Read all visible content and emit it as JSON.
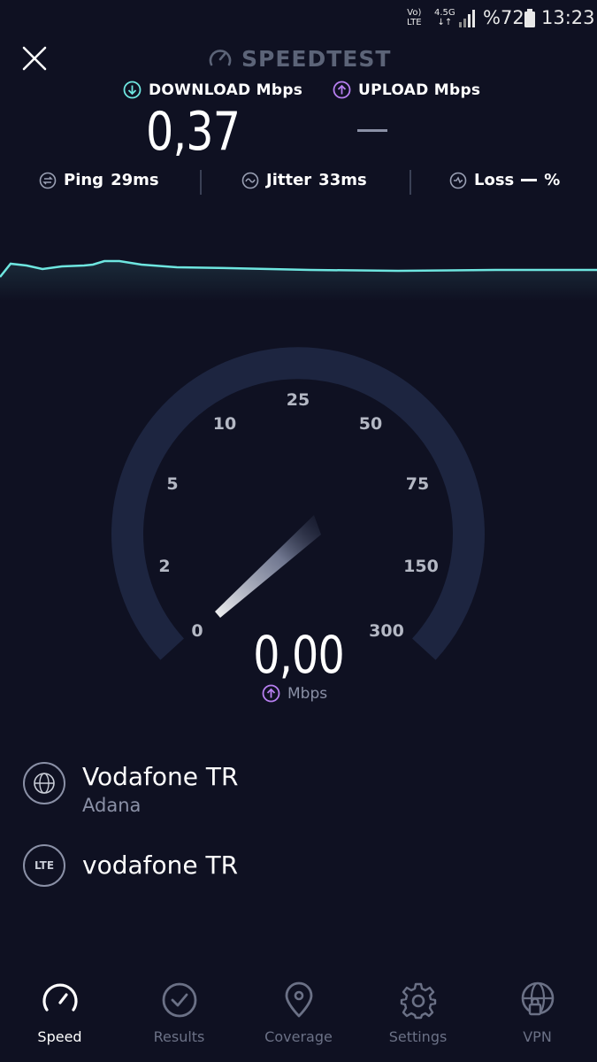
{
  "status_bar": {
    "volte_top": "Vo)",
    "volte_bottom": "LTE",
    "network_top": "4.5G",
    "network_bottom": "↓↑",
    "battery_percent": "%72",
    "time": "13:23"
  },
  "header": {
    "title": "SPEEDTEST"
  },
  "download": {
    "label": "DOWNLOAD Mbps",
    "value": "0,37",
    "color": "#6ee6e0"
  },
  "upload": {
    "label": "UPLOAD Mbps",
    "color": "#b77ff0"
  },
  "stats": {
    "ping_label": "Ping",
    "ping_value": "29ms",
    "jitter_label": "Jitter",
    "jitter_value": "33ms",
    "loss_label": "Loss",
    "loss_unit": "%"
  },
  "gauge": {
    "ticks": [
      "0",
      "2",
      "5",
      "10",
      "25",
      "50",
      "75",
      "150",
      "300"
    ],
    "value": "0,00",
    "unit": "Mbps"
  },
  "provider": {
    "isp_name": "Vodafone TR",
    "isp_location": "Adana",
    "connection_type": "LTE",
    "carrier_name": "vodafone TR"
  },
  "nav": {
    "items": [
      {
        "label": "Speed",
        "icon": "speedometer-icon",
        "active": true
      },
      {
        "label": "Results",
        "icon": "check-circle-icon",
        "active": false
      },
      {
        "label": "Coverage",
        "icon": "location-pin-icon",
        "active": false
      },
      {
        "label": "Settings",
        "icon": "gear-icon",
        "active": false
      },
      {
        "label": "VPN",
        "icon": "globe-lock-icon",
        "active": false
      }
    ]
  }
}
